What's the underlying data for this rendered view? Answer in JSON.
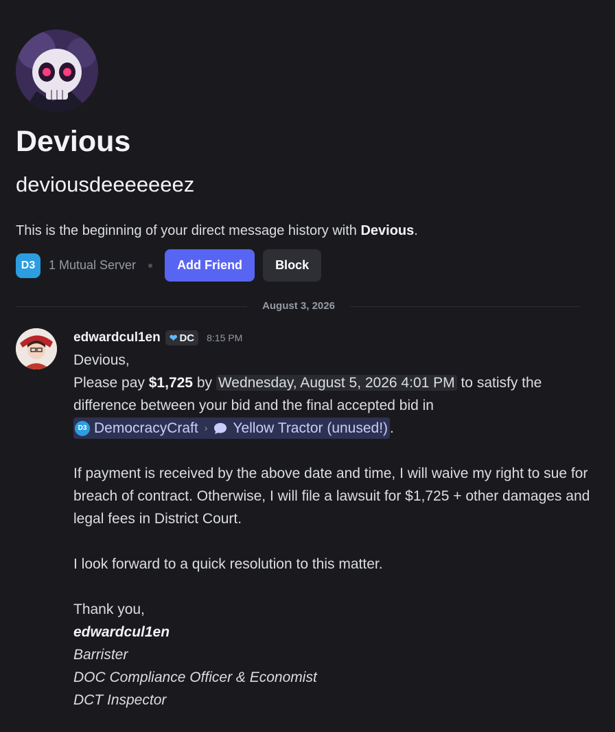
{
  "profile": {
    "display_name": "Devious",
    "username": "deviousdeeeeeeez",
    "intro_prefix": "This is the beginning of your direct message history with ",
    "intro_name": "Devious",
    "intro_suffix": ".",
    "mutual_server_icon_text": "D3",
    "mutual_servers": "1 Mutual Server",
    "add_friend_label": "Add Friend",
    "block_label": "Block"
  },
  "divider": {
    "date": "August 3, 2026"
  },
  "message": {
    "author": "edwardcul1en",
    "tag": "DC",
    "timestamp": "8:15 PM",
    "greeting": "Devious,",
    "line1_pre": "Please pay ",
    "amount": "$1,725",
    "line1_mid": " by ",
    "due_date": "Wednesday, August 5, 2026 4:01 PM",
    "line1_post": " to satisfy the difference between your bid and the final accepted bid in",
    "mention_server_icon_text": "D3",
    "mention_server": "DemocracyCraft",
    "mention_thread": "Yellow Tractor (unused!)",
    "mention_suffix": ".",
    "para2": "If payment is received by the above date and time, I will waive my right to sue for breach of contract. Otherwise, I will file a lawsuit for $1,725 + other damages and legal fees in District Court.",
    "para3": "I look forward to a quick resolution to this matter.",
    "closing": "Thank you,",
    "signature": "edwardcul1en",
    "title1": "Barrister",
    "title2": "DOC Compliance Officer & Economist",
    "title3": "DCT Inspector"
  },
  "colors": {
    "background": "#1a1a1e",
    "primary_button": "#5865f2",
    "secondary_button": "#2e2f34",
    "mention_bg": "#2d3252",
    "mention_text": "#c9cdfb"
  }
}
